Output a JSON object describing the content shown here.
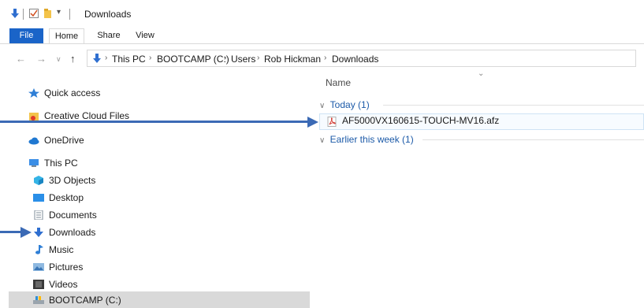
{
  "titlebar": {
    "title": "Downloads"
  },
  "ribbon": {
    "tabs": [
      "File",
      "Home",
      "Share",
      "View"
    ]
  },
  "address": {
    "crumbs": [
      "This PC",
      "BOOTCAMP (C:)",
      "Users",
      "Rob Hickman",
      "Downloads"
    ]
  },
  "nav": {
    "quick_access": "Quick access",
    "creative_cloud": "Creative Cloud Files",
    "onedrive": "OneDrive",
    "this_pc": "This PC",
    "objects3d": "3D Objects",
    "desktop": "Desktop",
    "documents": "Documents",
    "downloads": "Downloads",
    "music": "Music",
    "pictures": "Pictures",
    "videos": "Videos",
    "bootcamp": "BOOTCAMP (C:)"
  },
  "content": {
    "column_name": "Name",
    "group_today": "Today (1)",
    "group_earlier": "Earlier this week (1)",
    "file_name": "AF5000VX160615-TOUCH-MV16.afz"
  },
  "colors": {
    "accent": "#1a64c8",
    "arrow": "#3b6ab5",
    "group": "#1c5aa8"
  }
}
